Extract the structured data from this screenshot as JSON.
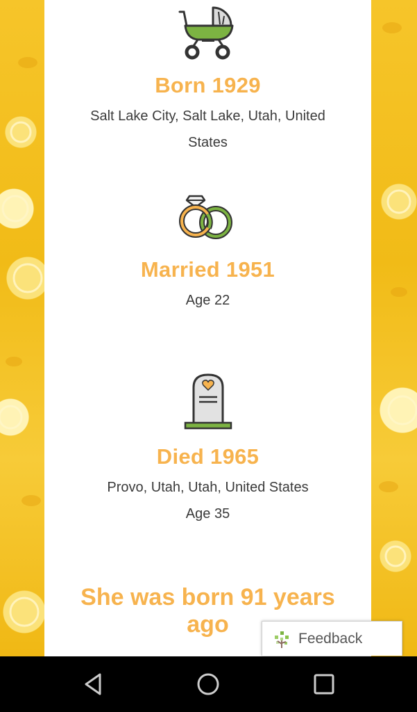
{
  "events": [
    {
      "icon": "baby-carriage-icon",
      "title": "Born 1929",
      "lines": [
        "Salt Lake City, Salt Lake, Utah, United",
        "States"
      ]
    },
    {
      "icon": "wedding-rings-icon",
      "title": "Married 1951",
      "lines": [
        "Age 22"
      ]
    },
    {
      "icon": "gravestone-icon",
      "title": "Died 1965",
      "lines": [
        "Provo, Utah, Utah, United States",
        "Age 35"
      ]
    }
  ],
  "summary": "She was born 91 years ago",
  "feedback": {
    "label": "Feedback",
    "icon": "family-tree-icon"
  },
  "navbar": {
    "back": "back-icon",
    "home": "home-icon",
    "recents": "recents-icon"
  },
  "colors": {
    "accent": "#f7b34e",
    "background": "#f4c21e",
    "green": "#7cb342"
  }
}
